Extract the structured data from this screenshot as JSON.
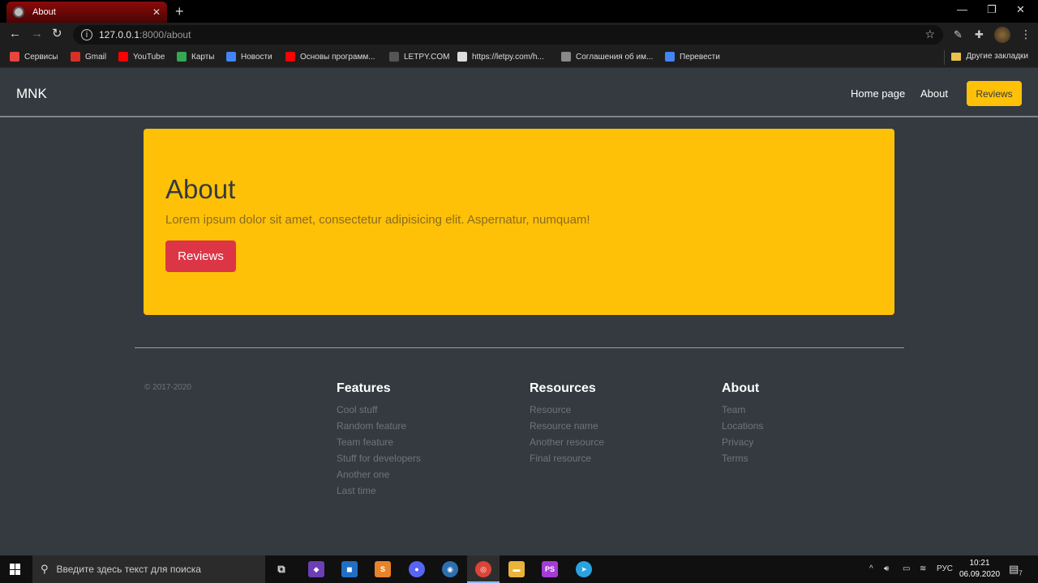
{
  "browser": {
    "tab_title": "About",
    "tab_close": "✕",
    "new_tab": "+",
    "url_host": "127.0.0.1",
    "url_path": ":8000/about",
    "bookmarks": [
      {
        "label": "Сервисы",
        "color": "#e8453c"
      },
      {
        "label": "Gmail",
        "color": "#d93025"
      },
      {
        "label": "YouTube",
        "color": "#ff0000"
      },
      {
        "label": "Карты",
        "color": "#34a853"
      },
      {
        "label": "Новости",
        "color": "#4285f4"
      },
      {
        "label": "Основы программ...",
        "color": "#ff0000"
      },
      {
        "label": "LETPY.COM",
        "color": "#555555"
      },
      {
        "label": "https://letpy.com/h...",
        "color": "#dddddd"
      },
      {
        "label": "Соглашения об им...",
        "color": "#888888"
      },
      {
        "label": "Перевести",
        "color": "#4285f4"
      }
    ],
    "other_bookmarks": "Другие закладки"
  },
  "site": {
    "brand": "MNK",
    "nav": {
      "home": "Home page",
      "about": "About",
      "reviews": "Reviews"
    },
    "jumbotron": {
      "title": "About",
      "text": "Lorem ipsum dolor sit amet, consectetur adipisicing elit. Aspernatur, numquam!",
      "button": "Reviews"
    },
    "footer": {
      "copyright": "© 2017-2020",
      "columns": [
        {
          "title": "Features",
          "items": [
            "Cool stuff",
            "Random feature",
            "Team feature",
            "Stuff for developers",
            "Another one",
            "Last time"
          ]
        },
        {
          "title": "Resources",
          "items": [
            "Resource",
            "Resource name",
            "Another resource",
            "Final resource"
          ]
        },
        {
          "title": "About",
          "items": [
            "Team",
            "Locations",
            "Privacy",
            "Terms"
          ]
        }
      ]
    },
    "colors": {
      "background": "#343a40",
      "warning": "#ffc107",
      "danger": "#dc3545",
      "muted": "#6c757d"
    }
  },
  "taskbar": {
    "search_placeholder": "Введите здесь текст для поиска",
    "language": "РУС",
    "time": "10:21",
    "date": "06.09.2020",
    "notifications": "7"
  }
}
